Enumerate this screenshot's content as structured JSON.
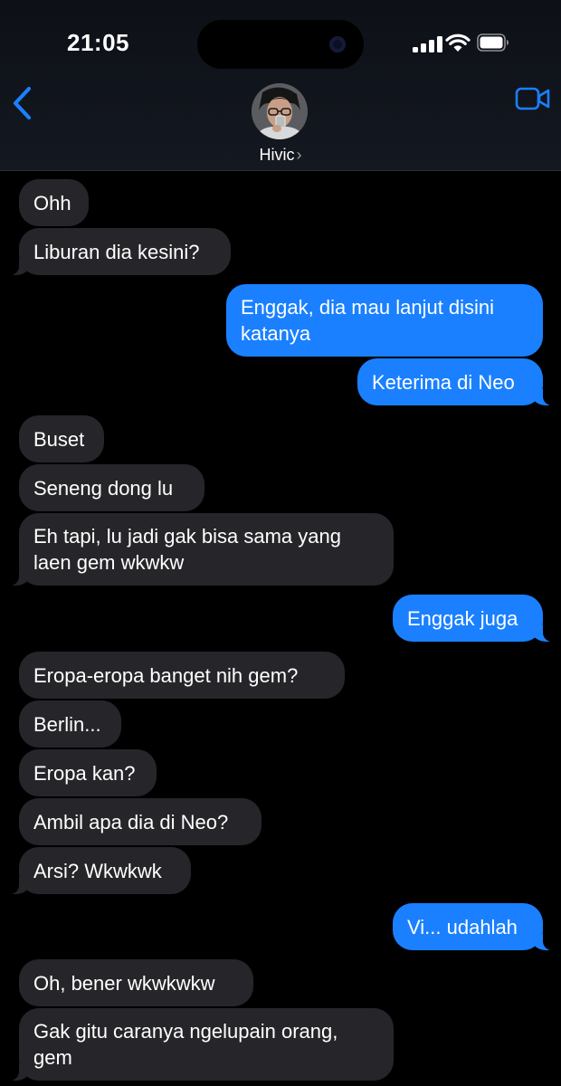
{
  "status_bar": {
    "time": "21:05"
  },
  "header": {
    "contact_name": "Hivic",
    "back_icon": "chevron-left-icon",
    "video_icon": "video-camera-icon",
    "accent_color": "#1a80ff"
  },
  "messages": [
    {
      "from": "them",
      "text": "Ohh"
    },
    {
      "from": "them",
      "text": "Liburan dia kesini?"
    },
    {
      "from": "me",
      "text": "Enggak, dia mau lanjut disini\nkatanya"
    },
    {
      "from": "me",
      "text": "Keterima di Neo"
    },
    {
      "from": "them",
      "text": "Buset"
    },
    {
      "from": "them",
      "text": "Seneng dong lu"
    },
    {
      "from": "them",
      "text": "Eh tapi, lu jadi gak bisa sama yang\nlaen gem wkwkw"
    },
    {
      "from": "me",
      "text": "Enggak juga"
    },
    {
      "from": "them",
      "text": "Eropa-eropa banget nih gem?"
    },
    {
      "from": "them",
      "text": "Berlin..."
    },
    {
      "from": "them",
      "text": "Eropa kan?"
    },
    {
      "from": "them",
      "text": "Ambil apa dia di Neo?"
    },
    {
      "from": "them",
      "text": "Arsi? Wkwkwk"
    },
    {
      "from": "me",
      "text": "Vi... udahlah"
    },
    {
      "from": "them",
      "text": "Oh, bener wkwkwkw"
    },
    {
      "from": "them",
      "text": "Gak gitu caranya ngelupain orang,\ngem"
    }
  ]
}
